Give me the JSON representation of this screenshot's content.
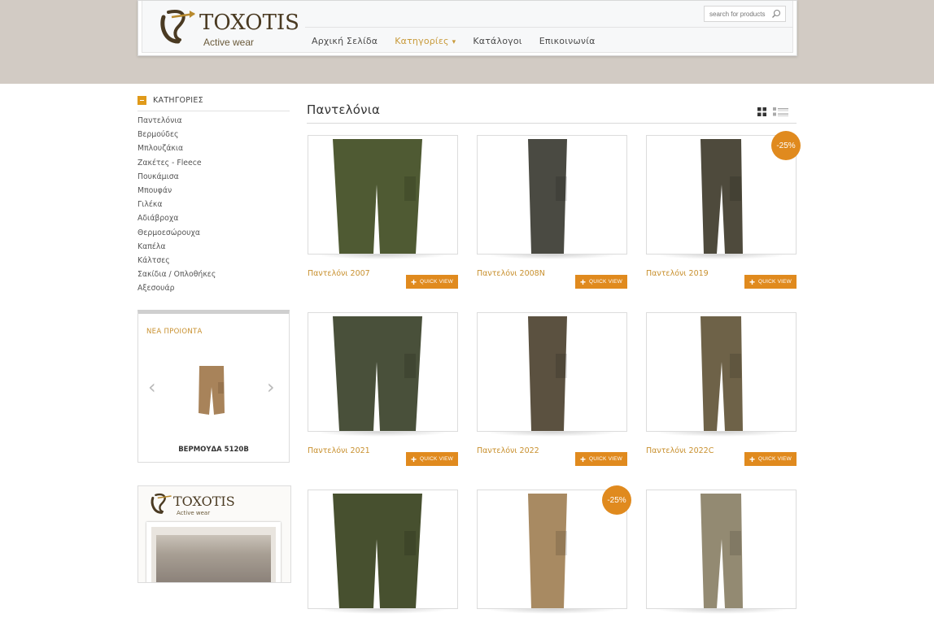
{
  "header": {
    "logo_text": "TOXOTIS",
    "logo_sub": "Active wear",
    "search_placeholder": "search for products",
    "nav": [
      {
        "label": "Αρχική Σελίδα"
      },
      {
        "label": "Κατηγορίες"
      },
      {
        "label": "Κατάλογοι"
      },
      {
        "label": "Επικοινωνία"
      }
    ]
  },
  "sidebar": {
    "categories_title": "ΚΑΤΗΓΟΡΙΕΣ",
    "categories": [
      "Παντελόνια",
      "Βερμούδες",
      "Μπλουζάκια",
      "Ζακέτες - Fleece",
      "Πουκάμισα",
      "Μπουφάν",
      "Γιλέκα",
      "Αδιάβροχα",
      "Θερμοεσώρουχα",
      "Καπέλα",
      "Κάλτσες",
      "Σακίδια / Οπλοθήκες",
      "Αξεσουάρ"
    ],
    "new_products_title": "ΝΕΑ ΠΡΟΙΟΝΤΑ",
    "new_product_name": "ΒΕΡΜΟΥΔΑ 5120Β",
    "catalog_logo_text": "TOXOTIS",
    "catalog_logo_sub": "Active wear"
  },
  "main": {
    "title": "Παντελόνια",
    "quick_view_label": "QUICK VIEW",
    "products": [
      {
        "name": "Παντελόνι 2007",
        "badge": "",
        "color": "#4f5a33"
      },
      {
        "name": "Παντελόνι 2008N",
        "badge": "",
        "color": "#4a4a42"
      },
      {
        "name": "Παντελόνι 2019",
        "badge": "-25%",
        "color": "#4e4a3c"
      },
      {
        "name": "Παντελόνι 2021",
        "badge": "",
        "color": "#49503a"
      },
      {
        "name": "Παντελόνι 2022",
        "badge": "",
        "color": "#5b5140"
      },
      {
        "name": "Παντελόνι 2022C",
        "badge": "",
        "color": "#6e6248"
      },
      {
        "name": "",
        "badge": "",
        "color": "#47502f"
      },
      {
        "name": "",
        "badge": "-25%",
        "color": "#a88a62"
      },
      {
        "name": "",
        "badge": "",
        "color": "#938a72"
      }
    ]
  },
  "colors": {
    "accent": "#e08a1e",
    "link_gold": "#c8902e",
    "top_band": "#d2cbc4"
  }
}
